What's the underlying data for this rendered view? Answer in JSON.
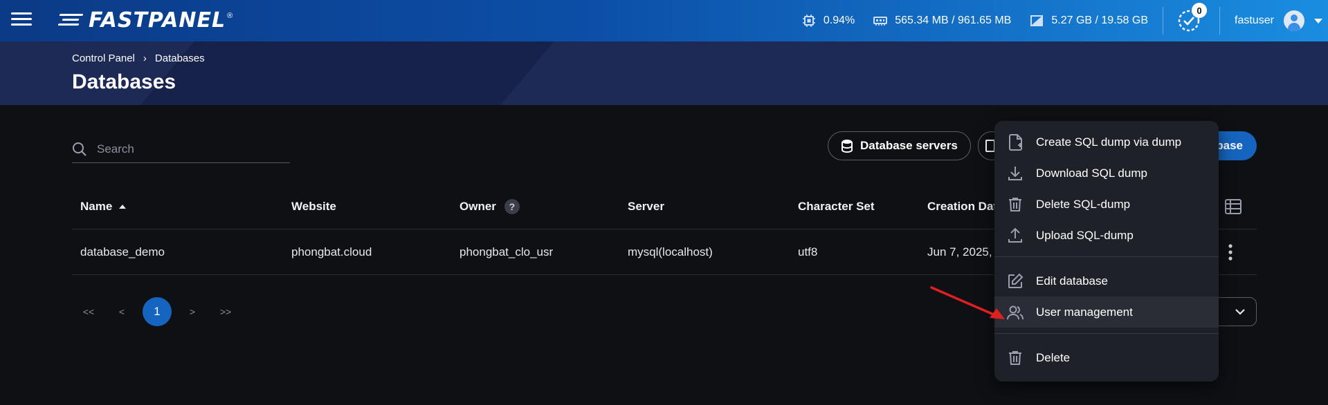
{
  "app": {
    "logo_text": "FASTPANEL",
    "logo_reg": "®"
  },
  "topbar": {
    "cpu": "0.94%",
    "ram": "565.34 MB / 961.65 MB",
    "disk": "5.27 GB / 19.58 GB",
    "tasks_count": "0",
    "username": "fastuser"
  },
  "breadcrumb": {
    "root": "Control Panel",
    "separator": "›",
    "current": "Databases"
  },
  "page": {
    "title": "Databases"
  },
  "search": {
    "placeholder": "Search",
    "value": ""
  },
  "toolbar": {
    "db_servers_label": "Database servers",
    "create_label": "base"
  },
  "table": {
    "headers": {
      "name": "Name",
      "website": "Website",
      "owner": "Owner",
      "owner_help": "?",
      "server": "Server",
      "charset": "Character Set",
      "created": "Creation Dat"
    },
    "rows": [
      {
        "name": "database_demo",
        "website": "phongbat.cloud",
        "owner": "phongbat_clo_usr",
        "server": "mysql(localhost)",
        "charset": "utf8",
        "created": "Jun 7, 2025,"
      }
    ]
  },
  "pagination": {
    "first": "<<",
    "prev": "<",
    "current": "1",
    "next": ">",
    "last": ">>"
  },
  "menu": {
    "items": [
      {
        "label": "Create SQL dump via dump",
        "icon": "file-add-icon"
      },
      {
        "label": "Download SQL dump",
        "icon": "download-icon"
      },
      {
        "label": "Delete SQL-dump",
        "icon": "trash-icon"
      },
      {
        "label": "Upload SQL-dump",
        "icon": "upload-icon"
      },
      {
        "label": "Edit database",
        "icon": "edit-icon"
      },
      {
        "label": "User management",
        "icon": "users-icon"
      },
      {
        "label": "Delete",
        "icon": "trash-icon"
      }
    ],
    "highlighted": "User management"
  },
  "colors": {
    "accent": "#1565c0",
    "annotation_arrow": "#e02020"
  }
}
